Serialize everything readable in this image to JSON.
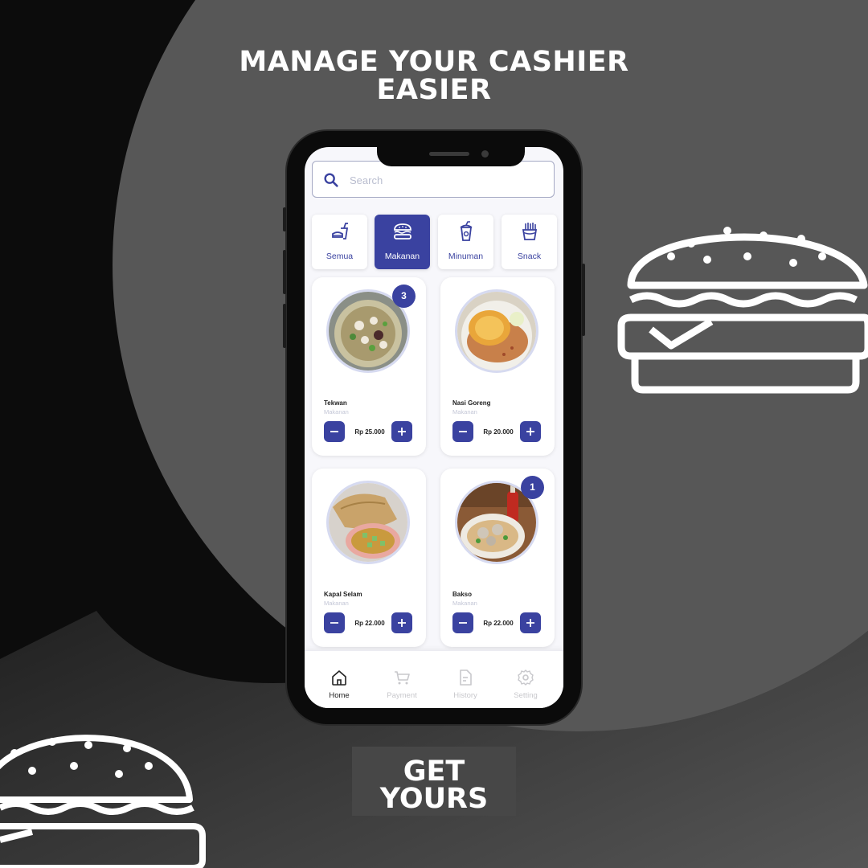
{
  "promo": {
    "headline_line1": "MANAGE YOUR CASHIER",
    "headline_line2": "EASIER",
    "cta_line1": "GET",
    "cta_line2": "YOURS"
  },
  "search": {
    "placeholder": "Search",
    "icon": "search-icon"
  },
  "categories": [
    {
      "label": "Semua",
      "icon": "fastfood-icon",
      "active": false
    },
    {
      "label": "Makanan",
      "icon": "burger-icon",
      "active": true
    },
    {
      "label": "Minuman",
      "icon": "drink-icon",
      "active": false
    },
    {
      "label": "Snack",
      "icon": "fries-icon",
      "active": false
    }
  ],
  "products": [
    {
      "name": "Tekwan",
      "category": "Makanan",
      "price": "Rp 25.000",
      "badge": "3"
    },
    {
      "name": "Nasi Goreng",
      "category": "Makanan",
      "price": "Rp 20.000",
      "badge": ""
    },
    {
      "name": "Kapal Selam",
      "category": "Makanan",
      "price": "Rp 22.000",
      "badge": ""
    },
    {
      "name": "Bakso",
      "category": "Makanan",
      "price": "Rp 22.000",
      "badge": "1"
    }
  ],
  "nav": [
    {
      "label": "Home",
      "icon": "home-icon",
      "active": true
    },
    {
      "label": "Payment",
      "icon": "cart-icon",
      "active": false
    },
    {
      "label": "History",
      "icon": "document-icon",
      "active": false
    },
    {
      "label": "Setting",
      "icon": "gear-icon",
      "active": false
    }
  ],
  "colors": {
    "accent": "#3a42a0",
    "background_dark": "#0c0c0c",
    "background_gray": "#575757"
  }
}
